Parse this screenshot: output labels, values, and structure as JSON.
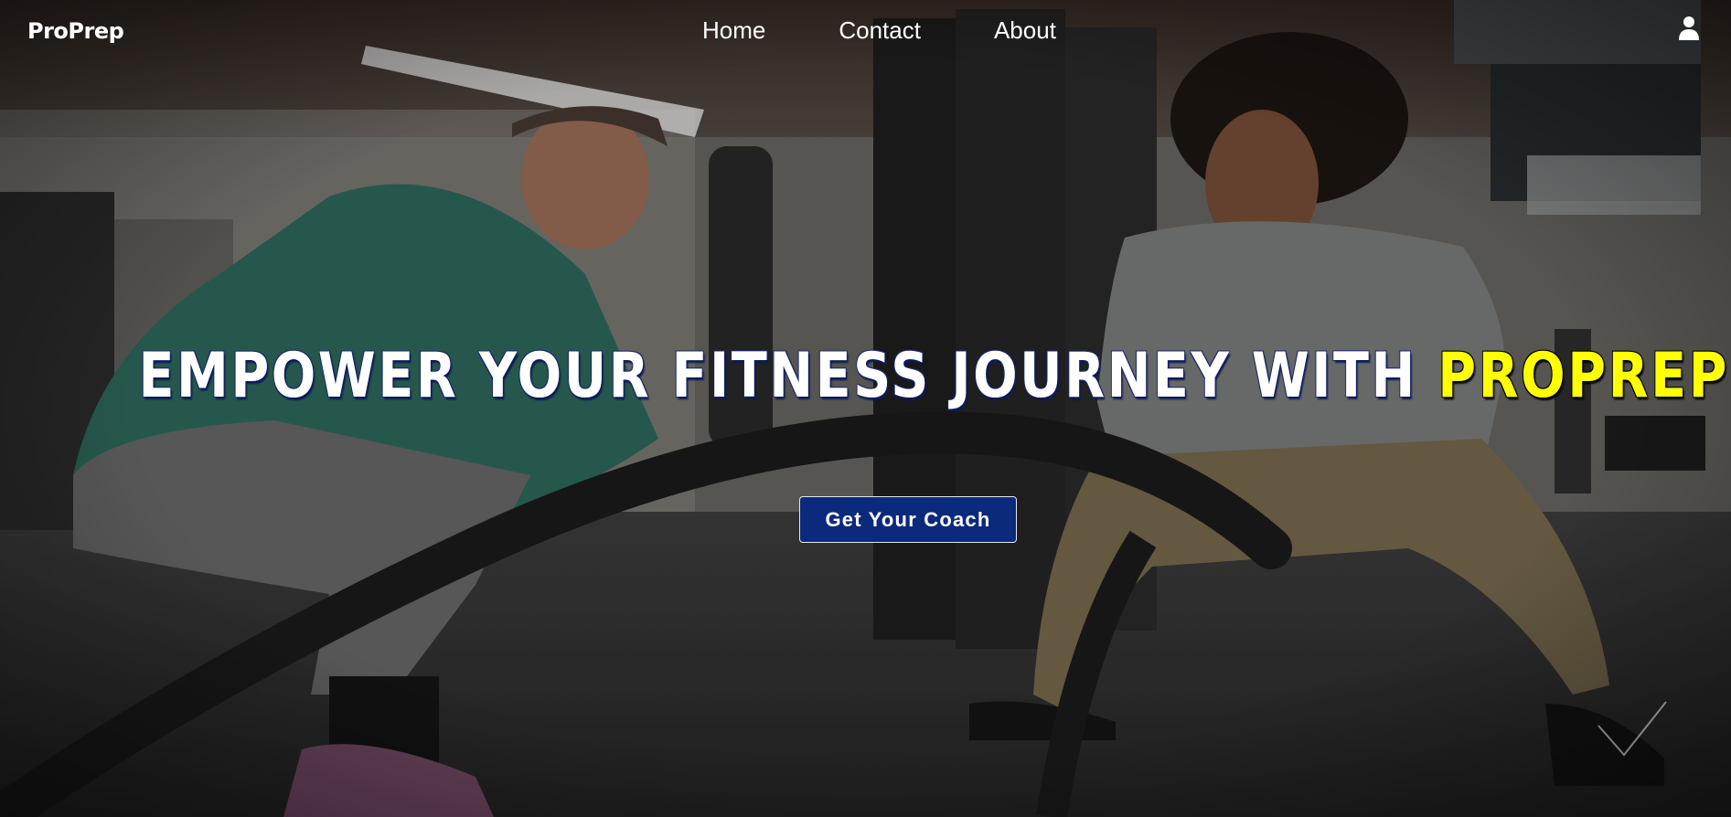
{
  "nav": {
    "brand": "ProPrep",
    "links": [
      "Home",
      "Contact",
      "About"
    ],
    "user_icon": "user-icon"
  },
  "hero": {
    "headline_main": "EMPOWER YOUR FITNESS JOURNEY WITH ",
    "headline_accent": "PROPREP",
    "cta_label": "Get Your Coach"
  },
  "colors": {
    "accent_yellow": "#ffff00",
    "cta_blue": "#0c2a7c",
    "text": "#ffffff"
  },
  "decor": {
    "corner_icon": "checkmark-icon"
  }
}
